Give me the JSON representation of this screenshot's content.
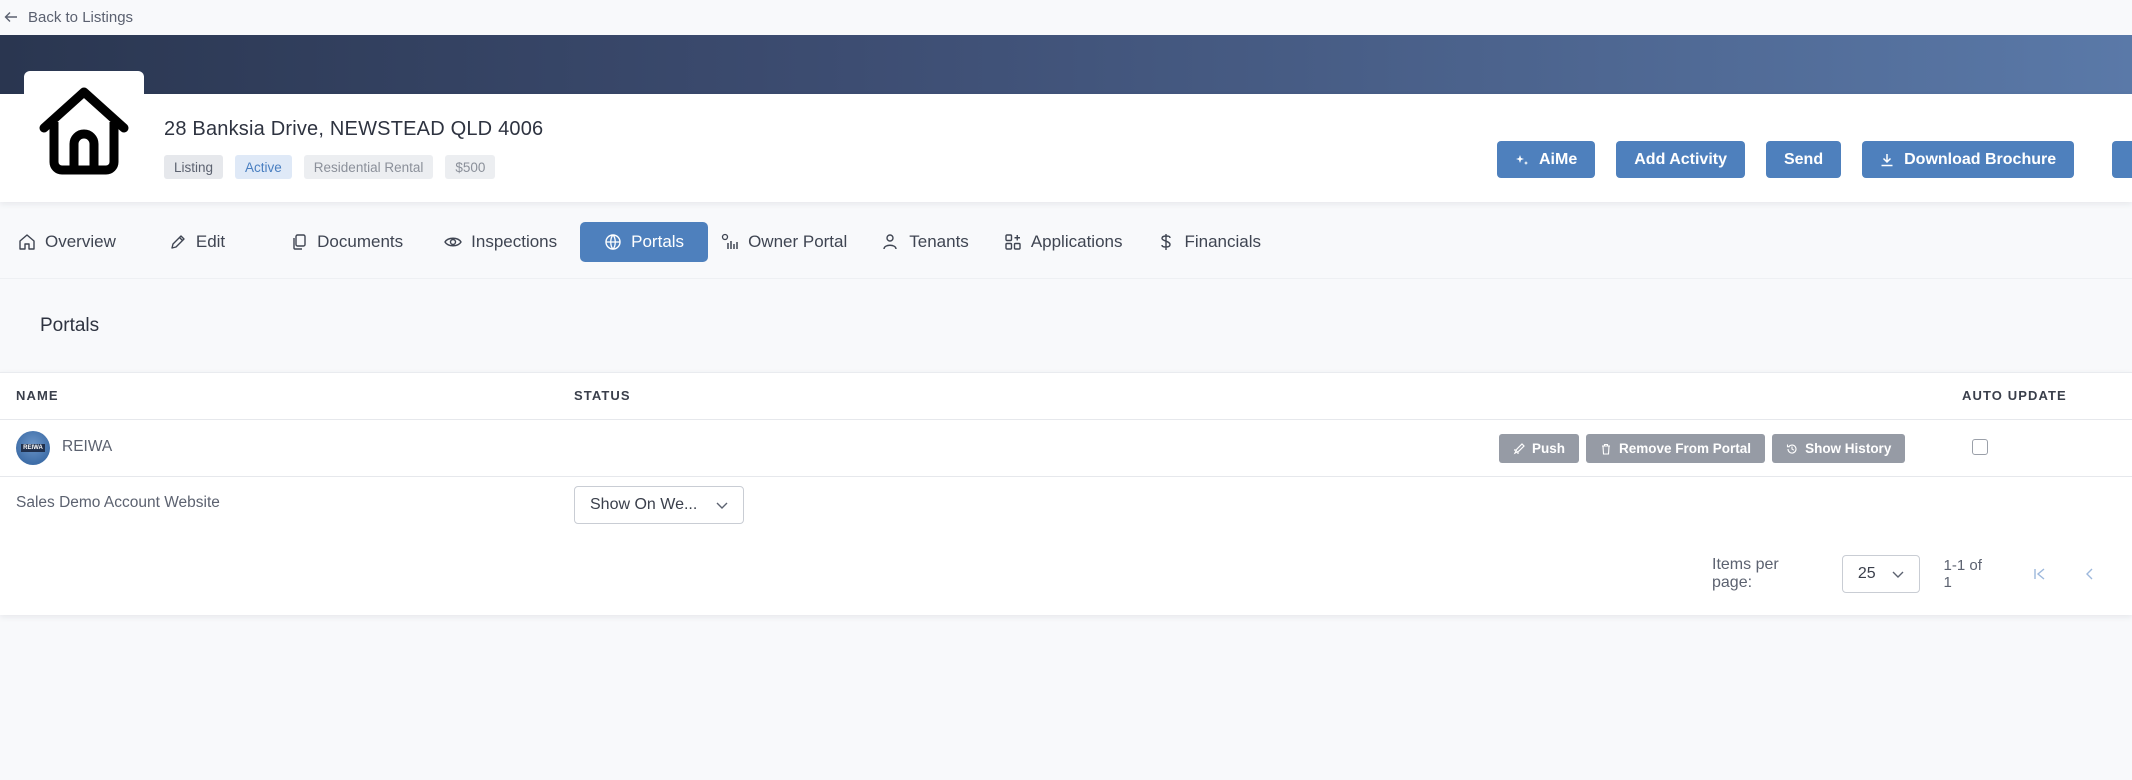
{
  "back": {
    "label": "Back to Listings",
    "icon": "arrow-left-icon"
  },
  "colors": {
    "accent": "#4e80bd",
    "active_badge_bg": "#dfe9f7",
    "banner_start": "#2a3650",
    "banner_end": "#5a79a8",
    "gray_button": "#969ba5"
  },
  "listing": {
    "address": "28 Banksia Drive, NEWSTEAD QLD 4006",
    "badges": [
      "Listing",
      "Active",
      "Residential Rental",
      "$500"
    ]
  },
  "header_actions": {
    "aime": "AiMe",
    "add_activity": "Add Activity",
    "send": "Send",
    "download_brochure": "Download Brochure"
  },
  "tabs": [
    {
      "label": "Overview",
      "icon": "home-icon"
    },
    {
      "label": "Edit",
      "icon": "pencil-icon"
    },
    {
      "label": "Documents",
      "icon": "documents-icon"
    },
    {
      "label": "Inspections",
      "icon": "eye-icon"
    },
    {
      "label": "Portals",
      "icon": "globe-icon",
      "selected": true
    },
    {
      "label": "Owner Portal",
      "icon": "owner-portal-icon"
    },
    {
      "label": "Tenants",
      "icon": "user-icon"
    },
    {
      "label": "Applications",
      "icon": "apps-icon"
    },
    {
      "label": "Financials",
      "icon": "dollar-icon"
    }
  ],
  "section": {
    "title": "Portals"
  },
  "table": {
    "headers": {
      "name": "NAME",
      "status": "STATUS",
      "auto_update": "AUTO UPDATE"
    },
    "rows": [
      {
        "name": "REIWA",
        "actions": {
          "push": "Push",
          "remove": "Remove From Portal",
          "history": "Show History"
        },
        "auto_update": false
      },
      {
        "name": "Sales Demo Account Website",
        "status_select": "Show On We..."
      }
    ]
  },
  "pagination": {
    "items_per_page_label": "Items per page:",
    "items_per_page": "25",
    "range": "1-1 of 1"
  }
}
